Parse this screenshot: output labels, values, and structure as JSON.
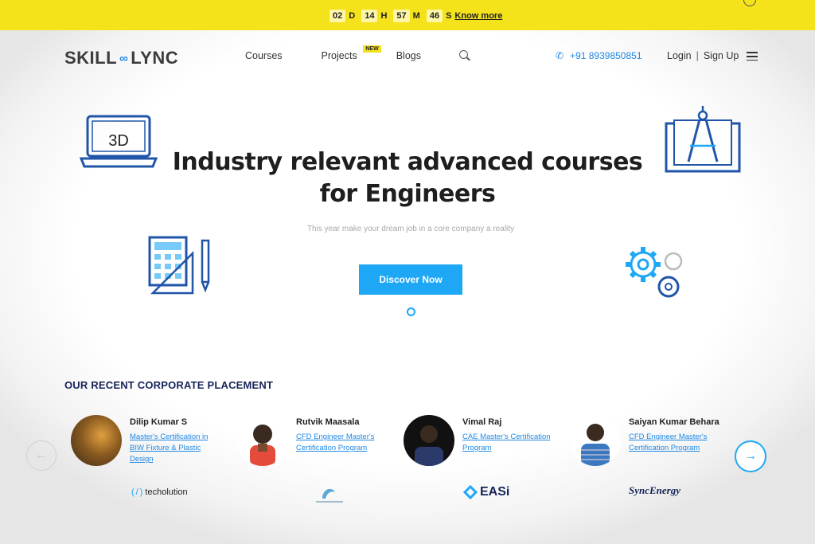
{
  "banner": {
    "countdown": [
      {
        "value": "02",
        "unit": "D"
      },
      {
        "value": "14",
        "unit": "H"
      },
      {
        "value": "57",
        "unit": "M"
      },
      {
        "value": "46",
        "unit": "S"
      }
    ],
    "know_more": "Know more",
    "color": "#f4e21b"
  },
  "header": {
    "logo_left": "SKILL",
    "logo_right": "LYNC",
    "nav": [
      {
        "label": "Courses"
      },
      {
        "label": "Projects",
        "badge": "NEW"
      },
      {
        "label": "Blogs"
      }
    ],
    "search_icon": "search-icon",
    "phone": "+91 8939850851",
    "login": "Login",
    "separator": "|",
    "signup": "Sign Up",
    "menu_icon": "hamburger-menu-icon"
  },
  "hero": {
    "title_line1": "Industry relevant advanced courses",
    "title_line2": "for Engineers",
    "subtitle": "This year make your dream job in a core company a reality",
    "cta": "Discover Now",
    "laptop_label": "3D",
    "accent": "#1ea7f5"
  },
  "placements": {
    "title": "OUR RECENT CORPORATE PLACEMENT",
    "cards": [
      {
        "name": "Dilip Kumar S",
        "program": "Master's Certification in BIW Fixture & Plastic Design",
        "company": "techolution"
      },
      {
        "name": "Rutvik Maasala",
        "program": "CFD Engineer Master's Certification Program",
        "company": ""
      },
      {
        "name": "Vimal Raj",
        "program": "CAE Master's Certification Program",
        "company": "EASi"
      },
      {
        "name": "Saiyan Kumar Behara",
        "program": "CFD Engineer Master's Certification Program",
        "company": "SyncEnergy"
      }
    ],
    "prev_icon": "arrow-left-icon",
    "next_icon": "arrow-right-icon"
  }
}
